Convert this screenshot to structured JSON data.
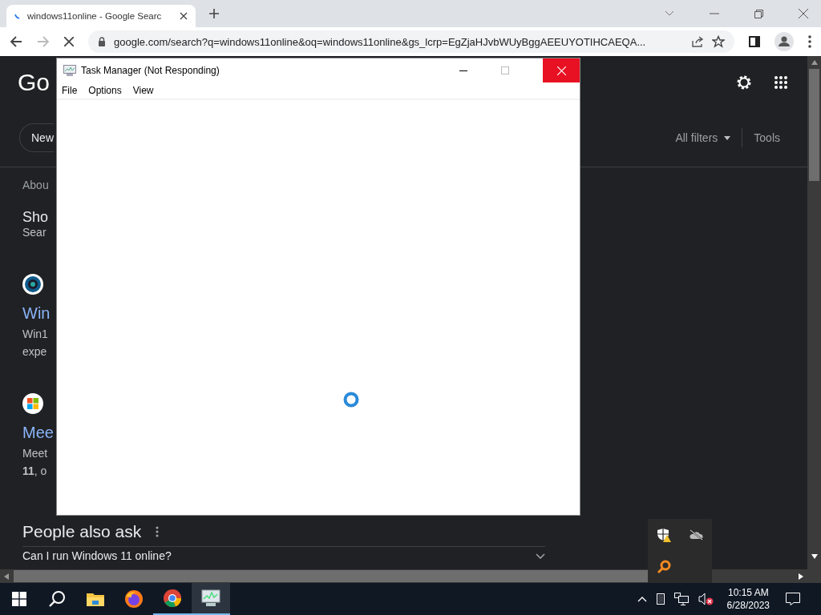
{
  "browser": {
    "tabs": [
      {
        "title": "windows11online - Google Searc",
        "selected": true
      }
    ],
    "address": "google.com/search?q=windows11online&oq=windows11online&gs_lcrp=EgZjaHJvbWUyBggAEEUYOTIHCAEQA..."
  },
  "page": {
    "logo": "Go",
    "chip": "New",
    "filters": [
      {
        "label": "All filters",
        "kind": "dropdown"
      },
      {
        "label": "Tools",
        "kind": "plain"
      }
    ],
    "stats": "Abou",
    "suggestion": {
      "title": "Sho",
      "subtitle": "Sear"
    },
    "results": [
      {
        "title": "Win",
        "lines": [
          "Win1",
          "expe"
        ]
      },
      {
        "title": "Mee",
        "lines": [
          "Meet",
          "**11**, o"
        ]
      }
    ],
    "people_also_ask": {
      "heading": "People also ask",
      "question": "Can I run Windows 11 online?"
    }
  },
  "task_manager": {
    "title": "Task Manager (Not Responding)",
    "menu": [
      "File",
      "Options",
      "View"
    ]
  },
  "tray_popup": [
    {
      "kind": "shield"
    },
    {
      "kind": "cloud"
    },
    {
      "kind": "search"
    }
  ],
  "taskbar": {
    "apps": [
      {
        "kind": "search",
        "running": false,
        "selected": false
      },
      {
        "kind": "explorer",
        "running": false,
        "selected": false
      },
      {
        "kind": "firefox",
        "running": false,
        "selected": false
      },
      {
        "kind": "chrome",
        "running": true,
        "selected": false
      },
      {
        "kind": "taskmgr",
        "running": true,
        "selected": true
      }
    ],
    "time": "10:15 AM",
    "date": "6/28/2023"
  }
}
